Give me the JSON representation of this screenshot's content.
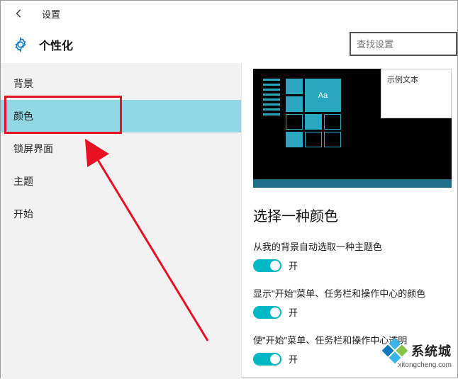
{
  "titlebar": {
    "title": "设置"
  },
  "header": {
    "page_title": "个性化",
    "search_placeholder": "查找设置"
  },
  "sidebar": {
    "items": [
      {
        "label": "背景"
      },
      {
        "label": "颜色"
      },
      {
        "label": "锁屏界面"
      },
      {
        "label": "主题"
      },
      {
        "label": "开始"
      }
    ]
  },
  "preview": {
    "sample_text": "示例文本",
    "tile_text": "Aa"
  },
  "content": {
    "section_title": "选择一种颜色",
    "settings": [
      {
        "label": "从我的背景自动选取一种主题色",
        "state": "开"
      },
      {
        "label": "显示\"开始\"菜单、任务栏和操作中心的颜色",
        "state": "开"
      },
      {
        "label": "使\"开始\"菜单、任务栏和操作中心透明",
        "state": "开"
      }
    ]
  },
  "watermark": {
    "brand": "系统城",
    "url": "xitongcheng.com"
  }
}
